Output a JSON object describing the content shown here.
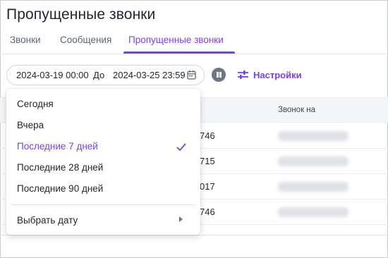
{
  "page": {
    "title": "Пропущенные звонки"
  },
  "tabs": [
    {
      "label": "Звонки",
      "active": false
    },
    {
      "label": "Сообщения",
      "active": false
    },
    {
      "label": "Пропущенные звонки",
      "active": true
    }
  ],
  "filter": {
    "from": "2024-03-19 00:00",
    "separator": "До",
    "to": "2024-03-25 23:59",
    "calendar_icon": "calendar-icon",
    "pause_icon": "pause-icon",
    "settings_label": "Настройки",
    "settings_icon": "sliders-icon"
  },
  "table": {
    "column_call": "Звонок на",
    "rows": [
      {
        "number": "746"
      },
      {
        "number": "715"
      },
      {
        "number": "017"
      },
      {
        "number": "746"
      }
    ]
  },
  "dropdown": {
    "options": [
      {
        "label": "Сегодня",
        "selected": false
      },
      {
        "label": "Вчера",
        "selected": false
      },
      {
        "label": "Последние 7 дней",
        "selected": true
      },
      {
        "label": "Последние 28 дней",
        "selected": false
      },
      {
        "label": "Последние 90 дней",
        "selected": false
      }
    ],
    "custom_label": "Выбрать дату",
    "check_icon": "check-icon",
    "arrow_icon": "chevron-right-icon"
  },
  "colors": {
    "accent": "#7a41e8",
    "text": "#23272c",
    "muted": "#5b6673",
    "header_bg": "#f4f5f7"
  }
}
